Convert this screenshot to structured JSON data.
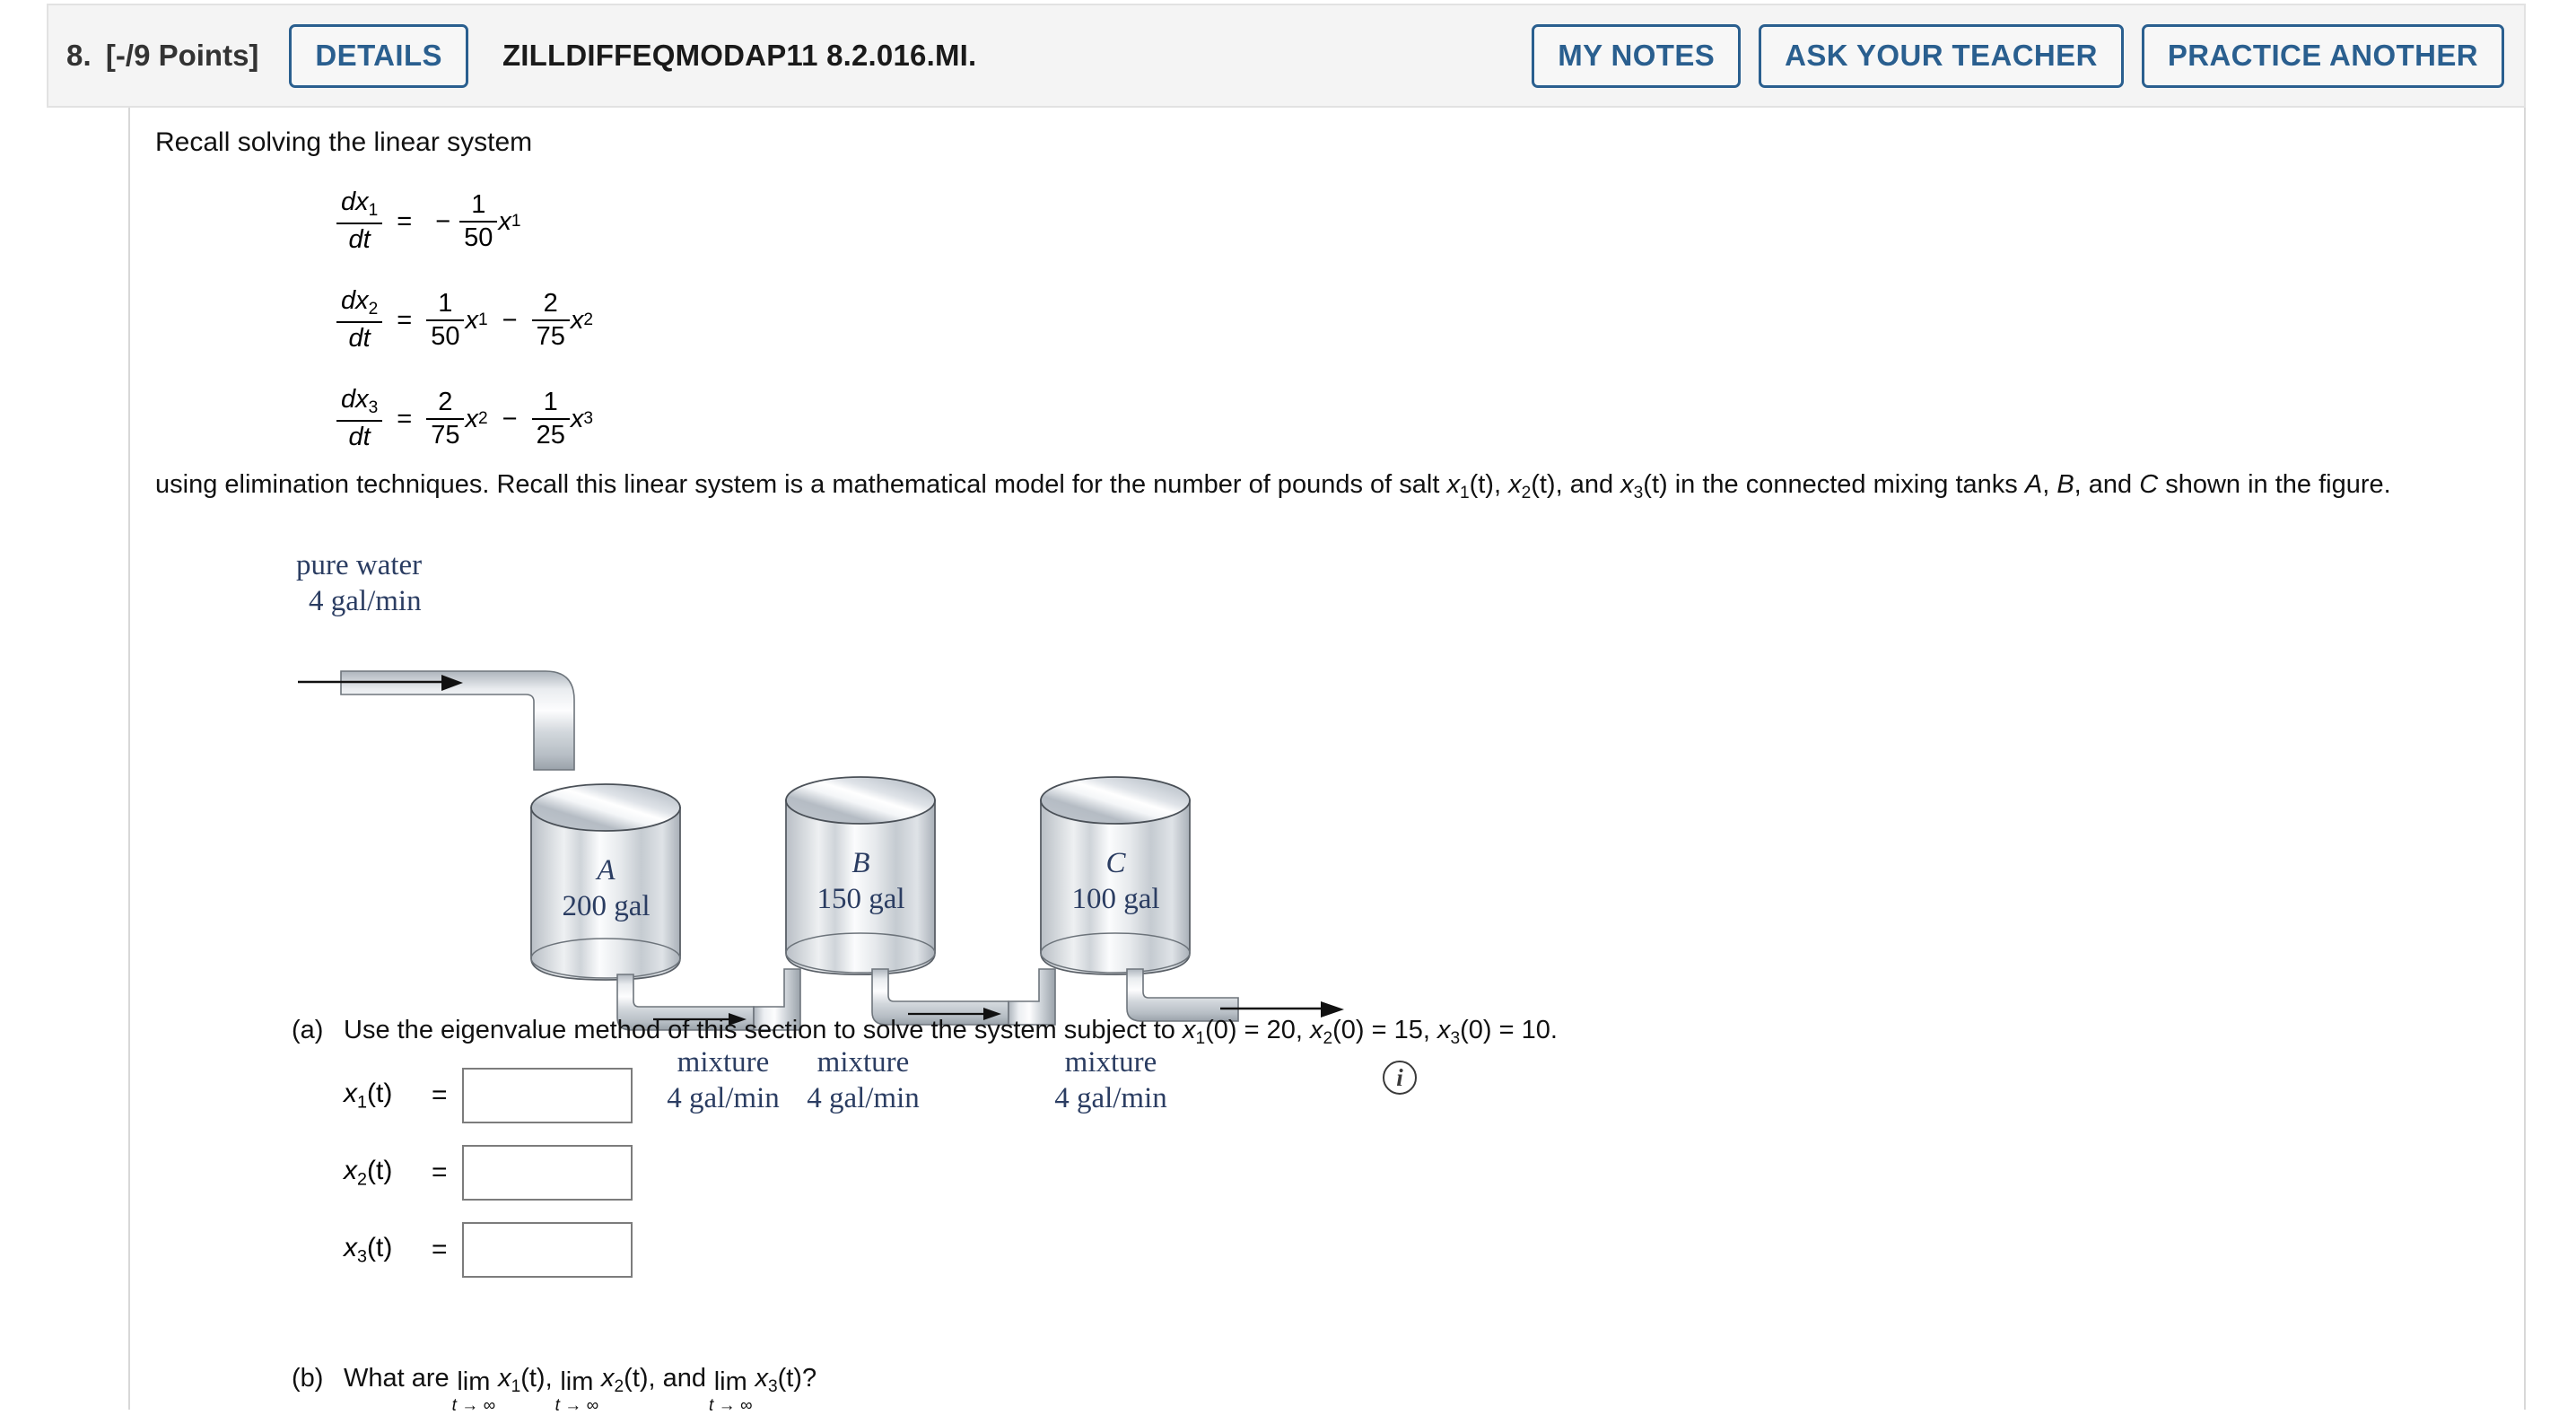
{
  "header": {
    "question_number": "8.",
    "points": "[-/9 Points]",
    "details_label": "DETAILS",
    "question_code": "ZILLDIFFEQMODAP11 8.2.016.MI.",
    "my_notes_label": "MY NOTES",
    "ask_teacher_label": "ASK YOUR TEACHER",
    "practice_another_label": "PRACTICE ANOTHER",
    "accent_color": "#2a5f8f",
    "background_color": "#f4f4f4"
  },
  "intro": "Recall solving the linear system",
  "equations": [
    {
      "lhs_num": "dx",
      "lhs_num_sub": "1",
      "lhs_den": "dt",
      "eq": "=",
      "sign": "−",
      "terms": [
        {
          "op": "",
          "num": "1",
          "den": "50",
          "var": "x",
          "var_sub": "1"
        }
      ]
    },
    {
      "lhs_num": "dx",
      "lhs_num_sub": "2",
      "lhs_den": "dt",
      "eq": "=",
      "sign": "",
      "terms": [
        {
          "op": "",
          "num": "1",
          "den": "50",
          "var": "x",
          "var_sub": "1"
        },
        {
          "op": "−",
          "num": "2",
          "den": "75",
          "var": "x",
          "var_sub": "2"
        }
      ]
    },
    {
      "lhs_num": "dx",
      "lhs_num_sub": "3",
      "lhs_den": "dt",
      "eq": "=",
      "sign": "",
      "terms": [
        {
          "op": "",
          "num": "2",
          "den": "75",
          "var": "x",
          "var_sub": "2"
        },
        {
          "op": "−",
          "num": "1",
          "den": "25",
          "var": "x",
          "var_sub": "3"
        }
      ]
    }
  ],
  "paragraph": {
    "part1": "using elimination techniques. Recall this linear system is a mathematical model for the number of pounds of salt ",
    "x1": "x",
    "x1_sub": "1",
    "x1_after": "(t), ",
    "x2": "x",
    "x2_sub": "2",
    "x2_after": "(t), and ",
    "x3": "x",
    "x3_sub": "3",
    "x3_after": "(t)",
    "part2": " in the connected mixing tanks ",
    "tankA": "A",
    "tankB": "B",
    "tankC": "C",
    "part3": " shown in the figure."
  },
  "figure": {
    "inlet_label_line1": "pure water",
    "inlet_label_line2": "4 gal/min",
    "tanks": [
      {
        "name": "A",
        "capacity": "200 gal"
      },
      {
        "name": "B",
        "capacity": "150 gal"
      },
      {
        "name": "C",
        "capacity": "100 gal"
      }
    ],
    "outflow_labels": [
      {
        "line1": "mixture",
        "line2": "4 gal/min"
      },
      {
        "line1": "mixture",
        "line2": "4 gal/min"
      },
      {
        "line1": "mixture",
        "line2": "4 gal/min"
      }
    ],
    "info_icon": "i",
    "label_color": "#2b3d62"
  },
  "part_a": {
    "label": "(a)",
    "text_before": "Use the eigenvalue method of this section to solve the system subject to ",
    "ic1_var": "x",
    "ic1_sub": "1",
    "ic1_rest": "(0) = 20, ",
    "ic2_var": "x",
    "ic2_sub": "2",
    "ic2_rest": "(0) = 15, ",
    "ic3_var": "x",
    "ic3_sub": "3",
    "ic3_rest": "(0) = 10.",
    "answers": [
      {
        "var": "x",
        "sub": "1",
        "rest": "(t)",
        "eq": "=",
        "value": "",
        "placeholder": ""
      },
      {
        "var": "x",
        "sub": "2",
        "rest": "(t)",
        "eq": "=",
        "value": "",
        "placeholder": ""
      },
      {
        "var": "x",
        "sub": "3",
        "rest": "(t)",
        "eq": "=",
        "value": "",
        "placeholder": ""
      }
    ]
  },
  "part_b": {
    "label": "(b)",
    "text_before": "What are ",
    "lim_top": "lim",
    "lim_bottom": "t → ∞",
    "l1_var": "x",
    "l1_sub": "1",
    "l1_rest": "(t), ",
    "l2_var": "x",
    "l2_sub": "2",
    "l2_rest": "(t), and ",
    "l3_var": "x",
    "l3_sub": "3",
    "l3_rest": "(t)?"
  }
}
